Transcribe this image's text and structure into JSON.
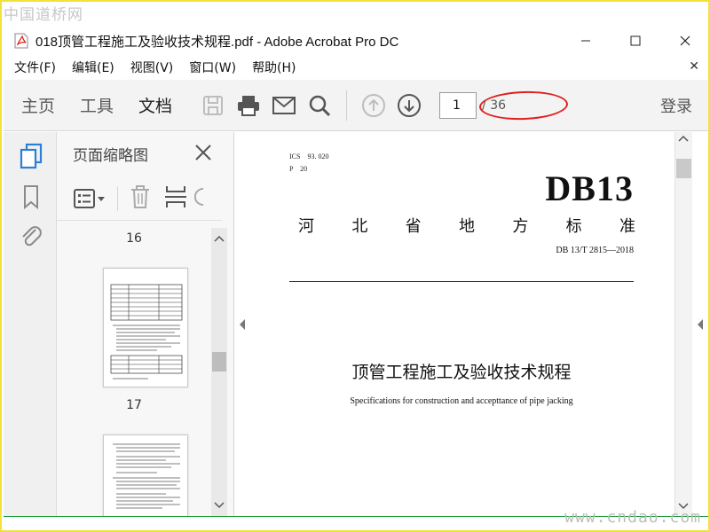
{
  "watermarks": {
    "top": "中国道桥网",
    "bottom": "www.cndao.com"
  },
  "window": {
    "title": "018顶管工程施工及验收技术规程.pdf - Adobe Acrobat Pro DC"
  },
  "menu": {
    "items": [
      "文件(F)",
      "编辑(E)",
      "视图(V)",
      "窗口(W)",
      "帮助(H)"
    ]
  },
  "toolbar": {
    "tabs": [
      "主页",
      "工具",
      "文档"
    ],
    "active_tab": "文档",
    "current_page": "1",
    "total_pages": "/ 36",
    "login": "登录"
  },
  "thumbnails": {
    "header": "页面缩略图",
    "page_labels": [
      "16",
      "17"
    ]
  },
  "document": {
    "ics": "ICS　93. 020",
    "p_code": "P　20",
    "db_code": "DB13",
    "standard_type_chars": [
      "河",
      "北",
      "省",
      "地",
      "方",
      "标",
      "准"
    ],
    "std_number": "DB 13/T 2815—2018",
    "title_cn": "顶管工程施工及验收技术规程",
    "title_en": "Specifications for construction and accepttance of pipe jacking"
  },
  "colors": {
    "frame": "#f3e23a",
    "highlight": "#e02020",
    "toolbar_bg": "#f3f3f3",
    "accent_blue": "#2b7fd6"
  }
}
